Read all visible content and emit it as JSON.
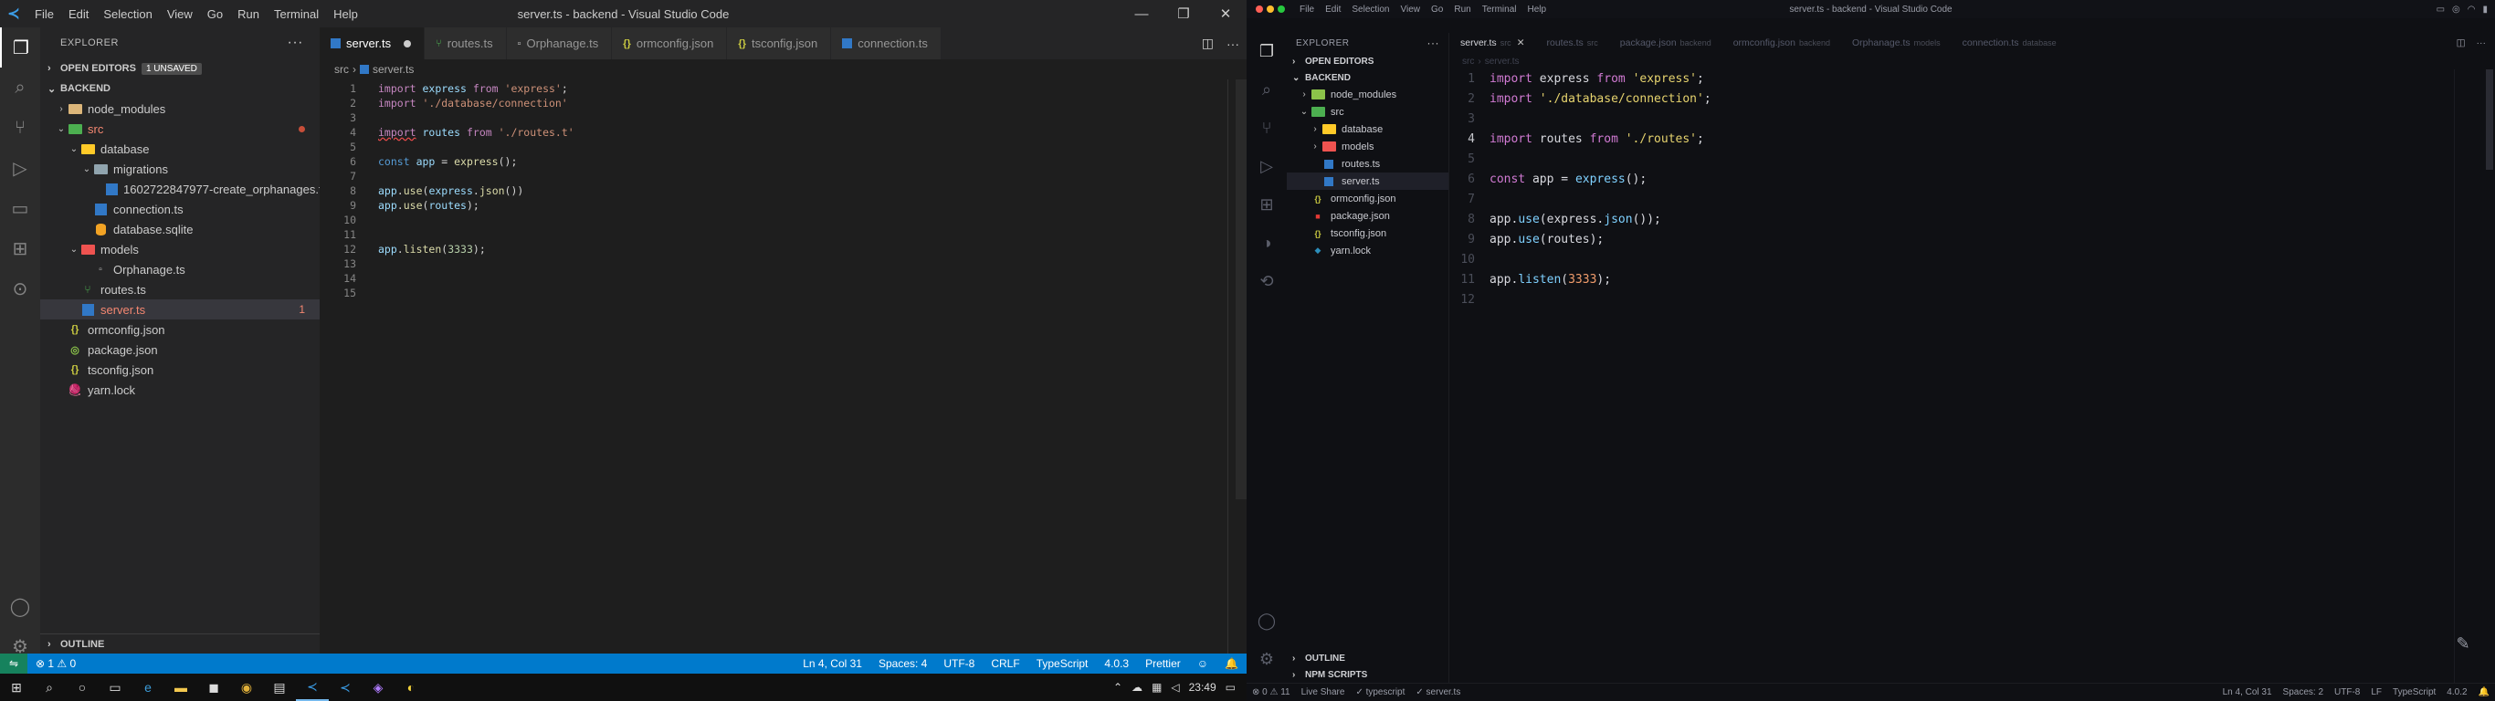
{
  "left": {
    "menu": [
      "File",
      "Edit",
      "Selection",
      "View",
      "Go",
      "Run",
      "Terminal",
      "Help"
    ],
    "window_title": "server.ts - backend - Visual Studio Code",
    "explorer_title": "EXPLORER",
    "open_editors": "OPEN EDITORS",
    "unsaved_badge": "1 UNSAVED",
    "root": "BACKEND",
    "tree": {
      "node_modules": "node_modules",
      "src": "src",
      "database": "database",
      "migrations": "migrations",
      "migration_file": "1602722847977-create_orphanages.ts",
      "connection": "connection.ts",
      "sqlite": "database.sqlite",
      "models": "models",
      "orphanage": "Orphanage.ts",
      "routes": "routes.ts",
      "server": "server.ts",
      "server_errors": "1",
      "ormconfig": "ormconfig.json",
      "package": "package.json",
      "tsconfig": "tsconfig.json",
      "yarn": "yarn.lock"
    },
    "outline": "OUTLINE",
    "tabs": [
      {
        "label": "server.ts",
        "icon": "ts"
      },
      {
        "label": "routes.ts",
        "icon": "route"
      },
      {
        "label": "Orphanage.ts",
        "icon": "model"
      },
      {
        "label": "ormconfig.json",
        "icon": "json"
      },
      {
        "label": "tsconfig.json",
        "icon": "json"
      },
      {
        "label": "connection.ts",
        "icon": "ts"
      }
    ],
    "breadcrumb": [
      "src",
      "server.ts"
    ],
    "code": [
      {
        "n": "1",
        "t": "import express from 'express';"
      },
      {
        "n": "2",
        "t": "import './database/connection'"
      },
      {
        "n": "3",
        "t": ""
      },
      {
        "n": "4",
        "t": "import routes from './routes.t'"
      },
      {
        "n": "5",
        "t": ""
      },
      {
        "n": "6",
        "t": "const app = express();"
      },
      {
        "n": "7",
        "t": ""
      },
      {
        "n": "8",
        "t": "app.use(express.json())"
      },
      {
        "n": "9",
        "t": "app.use(routes);"
      },
      {
        "n": "10",
        "t": ""
      },
      {
        "n": "11",
        "t": ""
      },
      {
        "n": "12",
        "t": "app.listen(3333);"
      },
      {
        "n": "13",
        "t": ""
      },
      {
        "n": "14",
        "t": ""
      },
      {
        "n": "15",
        "t": ""
      }
    ],
    "status": {
      "problems": "⊗ 1 ⚠ 0",
      "position": "Ln 4, Col 31",
      "spaces": "Spaces: 4",
      "encoding": "UTF-8",
      "eol": "CRLF",
      "language": "TypeScript",
      "version": "4.0.3",
      "prettier": "Prettier"
    }
  },
  "right": {
    "menu": [
      "File",
      "Edit",
      "Selection",
      "View",
      "Go",
      "Run",
      "Terminal",
      "Help"
    ],
    "window_title": "server.ts - backend - Visual Studio Code",
    "explorer_title": "EXPLORER",
    "open_editors": "OPEN EDITORS",
    "root": "BACKEND",
    "tree": {
      "node_modules": "node_modules",
      "src": "src",
      "database": "database",
      "models": "models",
      "routes": "routes.ts",
      "server": "server.ts",
      "ormconfig": "ormconfig.json",
      "package": "package.json",
      "tsconfig": "tsconfig.json",
      "yarn": "yarn.lock"
    },
    "outline": "OUTLINE",
    "npm_scripts": "NPM SCRIPTS",
    "tabs": [
      {
        "label": "server.ts",
        "sub": "src"
      },
      {
        "label": "routes.ts",
        "sub": "src"
      },
      {
        "label": "package.json",
        "sub": "backend"
      },
      {
        "label": "ormconfig.json",
        "sub": "backend"
      },
      {
        "label": "Orphanage.ts",
        "sub": "models"
      },
      {
        "label": "connection.ts",
        "sub": "database"
      }
    ],
    "breadcrumb": [
      "src",
      "server.ts"
    ],
    "code": [
      {
        "n": "1",
        "t": "import express from 'express';"
      },
      {
        "n": "2",
        "t": "import './database/connection';"
      },
      {
        "n": "3",
        "t": ""
      },
      {
        "n": "4",
        "t": "import routes from './routes';"
      },
      {
        "n": "5",
        "t": ""
      },
      {
        "n": "6",
        "t": "const app = express();"
      },
      {
        "n": "7",
        "t": ""
      },
      {
        "n": "8",
        "t": "app.use(express.json());"
      },
      {
        "n": "9",
        "t": "app.use(routes);"
      },
      {
        "n": "10",
        "t": ""
      },
      {
        "n": "11",
        "t": "app.listen(3333);"
      },
      {
        "n": "12",
        "t": ""
      }
    ],
    "status": {
      "problems": "⊗ 0 ⚠ 11",
      "live_share": "Live Share",
      "lang_check": "✓ typescript",
      "file": "✓ server.ts",
      "position": "Ln 4, Col 31",
      "spaces": "Spaces: 2",
      "encoding": "UTF-8",
      "eol": "LF",
      "language": "TypeScript",
      "version": "4.0.2"
    }
  },
  "taskbar": {
    "time": "23:49"
  }
}
